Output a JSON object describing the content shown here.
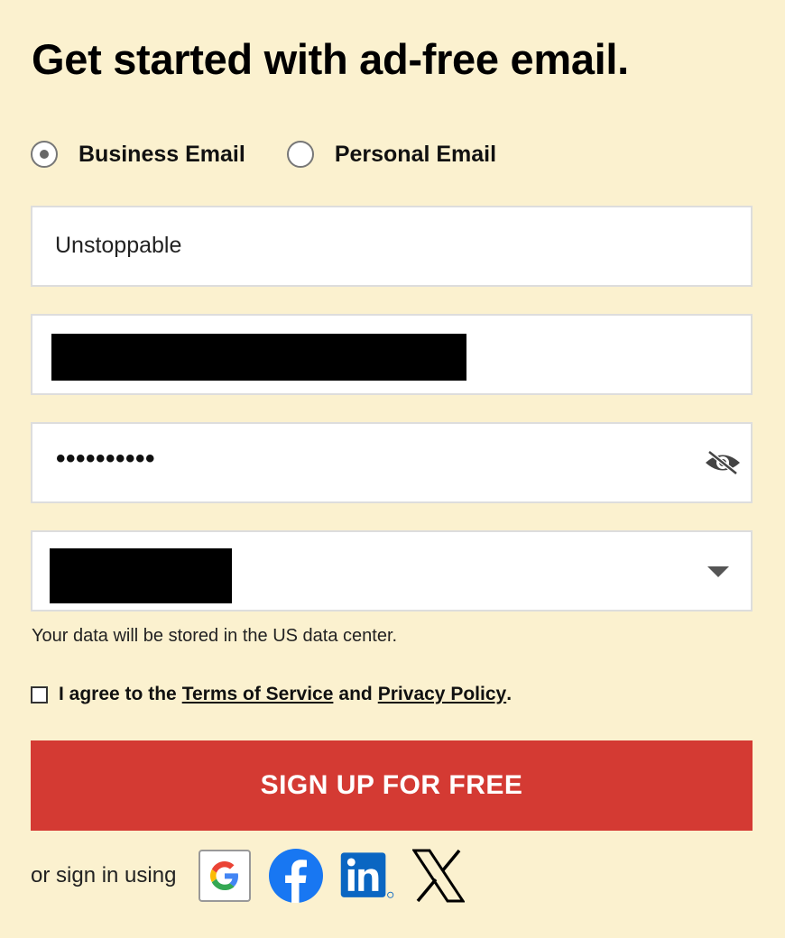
{
  "header": {
    "title": "Get started with ad-free email."
  },
  "account_type": {
    "options": [
      {
        "label": "Business Email",
        "selected": true
      },
      {
        "label": "Personal Email",
        "selected": false
      }
    ]
  },
  "form": {
    "company_value": "Unstoppable",
    "email_value": "[redacted]",
    "password_value": "••••••••••",
    "country_value": "[redacted]"
  },
  "notes": {
    "data_center": "Your data will be stored in the US data center."
  },
  "agreement": {
    "prefix": "I agree to the",
    "terms_link": "Terms of Service",
    "joiner": "and",
    "privacy_link": "Privacy Policy",
    "suffix": "."
  },
  "signup_button": {
    "label": "SIGN UP FOR FREE",
    "color": "#d43a33"
  },
  "social": {
    "label": "or sign in using",
    "providers": [
      "google-icon",
      "facebook-icon",
      "linkedin-icon",
      "x-icon"
    ]
  },
  "colors": {
    "background": "#fbf1cf",
    "accent": "#d43a33"
  }
}
